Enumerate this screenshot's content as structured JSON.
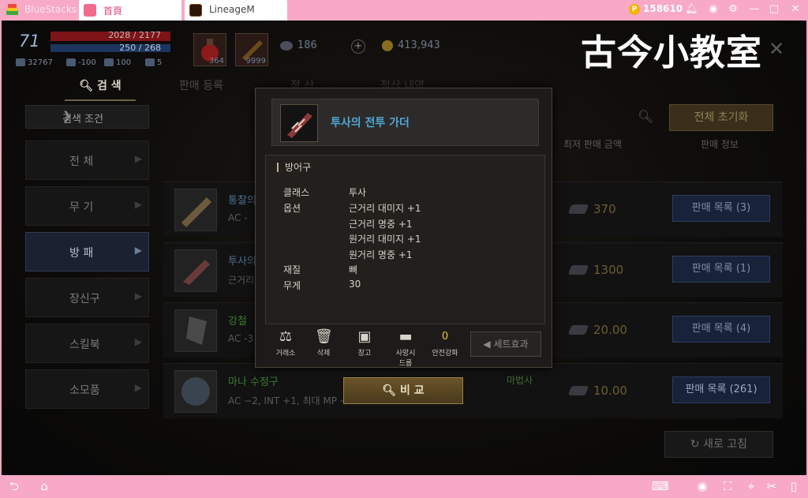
{
  "titlebar": {
    "app_name": "BlueStacks",
    "tabs": [
      {
        "label": "首頁"
      },
      {
        "label": "LineageM"
      }
    ],
    "coins": "158610",
    "coin_symbol": "P"
  },
  "hud": {
    "level": "71",
    "hp": "2028 / 2177",
    "mp": "250 / 268",
    "stats": [
      "32767",
      "-100",
      "100",
      "5"
    ],
    "slots": [
      {
        "count": "364"
      },
      {
        "count": "9999"
      }
    ],
    "resource1": "186",
    "gold": "413,943",
    "watermark": "古今小教室"
  },
  "nav": {
    "tabs": [
      "검 색",
      "판매 등록",
      "정 산",
      "정산 내역"
    ],
    "search_condition": "검색 조건",
    "categories": [
      "전 체",
      "무 기",
      "방 패",
      "장신구",
      "스킬북",
      "소모품"
    ]
  },
  "list": {
    "headers": [
      "최저 판매 금액",
      "판매 정보"
    ],
    "reset": "전체 초기화",
    "refresh": "새로 고침",
    "rows": [
      {
        "name": "통찰의",
        "desc": "AC -",
        "class": "",
        "price": "370",
        "button": "판매 목록 (3)"
      },
      {
        "name": "투사의",
        "desc": "근거리",
        "class": "",
        "price": "1300",
        "button": "판매 목록 (1)"
      },
      {
        "name": "강철",
        "desc": "AC -3",
        "class": "",
        "price": "20.00",
        "button": "판매 목록 (4)"
      },
      {
        "name": "마나 수정구",
        "desc": "AC −2, INT +1, 최대 MP +",
        "class": "마법사",
        "price": "10.00",
        "button": "판매 목록 (261)"
      }
    ]
  },
  "popup": {
    "title": "투사의 전투 가더",
    "section": "방어구",
    "fields": [
      {
        "label": "클래스",
        "value": "투사"
      },
      {
        "label": "옵션",
        "value": "근거리 대미지 +1"
      },
      {
        "label": "",
        "value": "근거리 명중 +1"
      },
      {
        "label": "",
        "value": "원거리 대미지 +1"
      },
      {
        "label": "",
        "value": "원거리 명중 +1"
      },
      {
        "label": "재질",
        "value": "뼈"
      },
      {
        "label": "무게",
        "value": "30"
      }
    ],
    "actions": [
      {
        "label": "거래소",
        "icon": "scale-icon"
      },
      {
        "label": "삭제",
        "icon": "trash-icon"
      },
      {
        "label": "창고",
        "icon": "chest-icon"
      },
      {
        "label": "사망시 드롭",
        "label1": "사망시",
        "label2": "드롭",
        "icon": "anvil-icon"
      },
      {
        "label": "안전강화",
        "icon": "safe-enchant-icon",
        "badge": "0"
      }
    ],
    "set_effect": "세트효과",
    "compare": "비 교"
  },
  "colors": {
    "title_bar": "#f7a9c6",
    "item_title": "#4fa8d6",
    "hp": "#7c1418",
    "mp": "#1c355e"
  }
}
